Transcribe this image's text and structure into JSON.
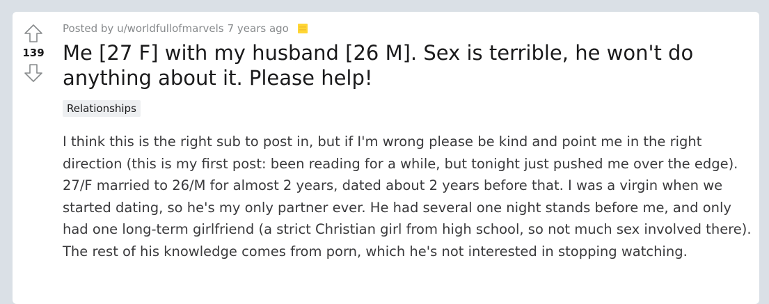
{
  "post": {
    "score": "139",
    "posted_by_prefix": "Posted by",
    "author": "u/worldfullofmarvels",
    "time": "7 years ago",
    "award_icon": "award-icon",
    "title": "Me [27 F] with my husband [26 M]. Sex is terrible, he won't do anything about it. Please help!",
    "flair": "Relationships",
    "body": "I think this is the right sub to post in, but if I'm wrong please be kind and point me in the right direction (this is my first post: been reading for a while, but tonight just pushed me over the edge). 27/F married to 26/M for almost 2 years, dated about 2 years before that. I was a virgin when we started dating, so he's my only partner ever. He had several one night stands before me, and only had one long-term girlfriend (a strict Christian girl from high school, so not much sex involved there). The rest of his knowledge comes from porn, which he's not interested in stopping watching."
  },
  "colors": {
    "page_bg": "#dae0e6",
    "card_bg": "#ffffff",
    "meta_text": "#878a8c",
    "award": "#ffd635",
    "icon_stroke": "#878a8c"
  }
}
